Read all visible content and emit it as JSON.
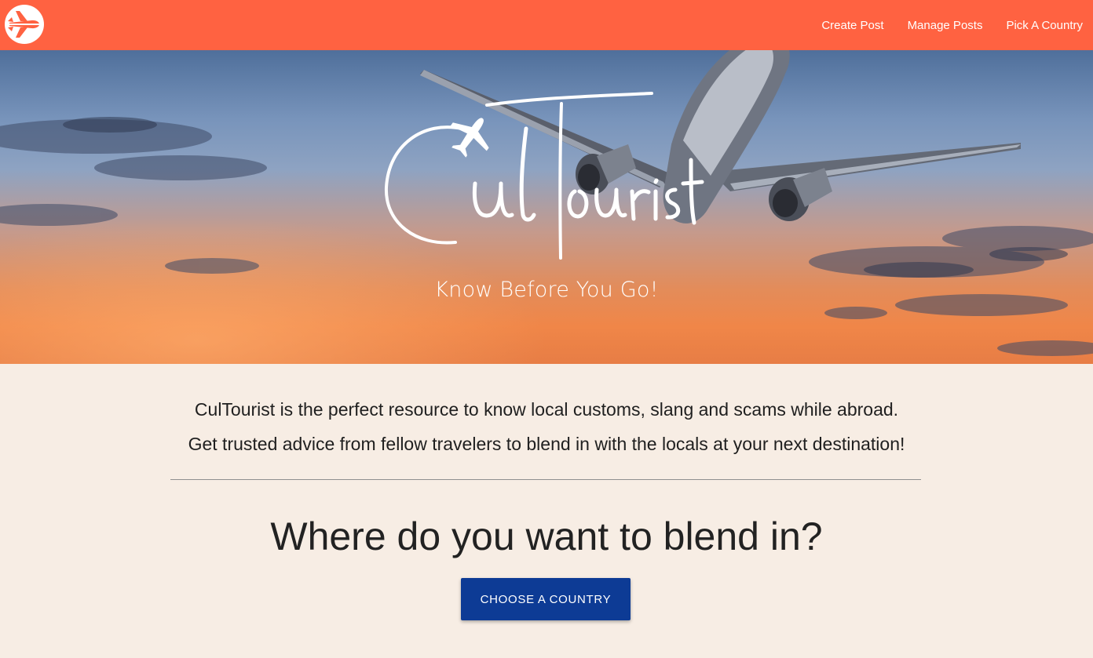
{
  "navbar": {
    "logo_icon": "airplane-circle-icon",
    "links": [
      {
        "label": "Create Post"
      },
      {
        "label": "Manage Posts"
      },
      {
        "label": "Pick A Country"
      }
    ],
    "background_color": "#ff6241"
  },
  "hero": {
    "brand": "CulTourist",
    "tagline": "Know Before You Go!"
  },
  "intro": {
    "line1": "CulTourist is the perfect resource to know local customs, slang and scams while abroad.",
    "line2": "Get trusted advice from fellow travelers to blend in with the locals at your next destination!"
  },
  "main": {
    "headline": "Where do you want to blend in?",
    "cta_label": "Choose a country",
    "cta_color": "#0d3b95"
  },
  "colors": {
    "accent": "#ff6241",
    "page_background": "#f7ede4"
  }
}
